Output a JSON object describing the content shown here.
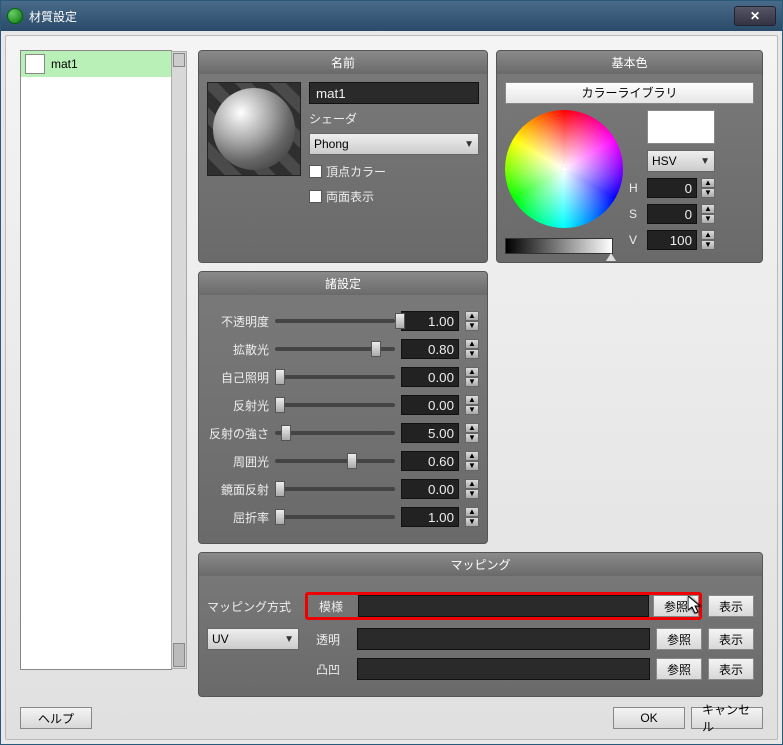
{
  "window": {
    "title": "材質設定"
  },
  "materials": {
    "items": [
      {
        "name": "mat1"
      }
    ]
  },
  "name_panel": {
    "header": "名前",
    "name_value": "mat1",
    "shader_label": "シェーダ",
    "shader_value": "Phong",
    "vertex_color_label": "頂点カラー",
    "double_sided_label": "両面表示"
  },
  "color_panel": {
    "header": "基本色",
    "library_btn": "カラーライブラリ",
    "mode": "HSV",
    "h_label": "H",
    "h_value": "0",
    "s_label": "S",
    "s_value": "0",
    "v_label": "V",
    "v_value": "100"
  },
  "settings_panel": {
    "header": "諸設定",
    "rows": [
      {
        "label": "不透明度",
        "value": "1.00",
        "pos": 100
      },
      {
        "label": "拡散光",
        "value": "0.80",
        "pos": 80
      },
      {
        "label": "自己照明",
        "value": "0.00",
        "pos": 0
      },
      {
        "label": "反射光",
        "value": "0.00",
        "pos": 0
      },
      {
        "label": "反射の強さ",
        "value": "5.00",
        "pos": 5
      },
      {
        "label": "周囲光",
        "value": "0.60",
        "pos": 60
      },
      {
        "label": "鏡面反射",
        "value": "0.00",
        "pos": 0
      },
      {
        "label": "屈折率",
        "value": "1.00",
        "pos": 0
      }
    ]
  },
  "mapping_panel": {
    "header": "マッピング",
    "method_label": "マッピング方式",
    "method_value": "UV",
    "rows": [
      {
        "label": "模様",
        "browse": "参照",
        "show": "表示"
      },
      {
        "label": "透明",
        "browse": "参照",
        "show": "表示"
      },
      {
        "label": "凸凹",
        "browse": "参照",
        "show": "表示"
      }
    ]
  },
  "footer": {
    "help": "ヘルプ",
    "ok": "OK",
    "cancel": "キャンセル"
  }
}
